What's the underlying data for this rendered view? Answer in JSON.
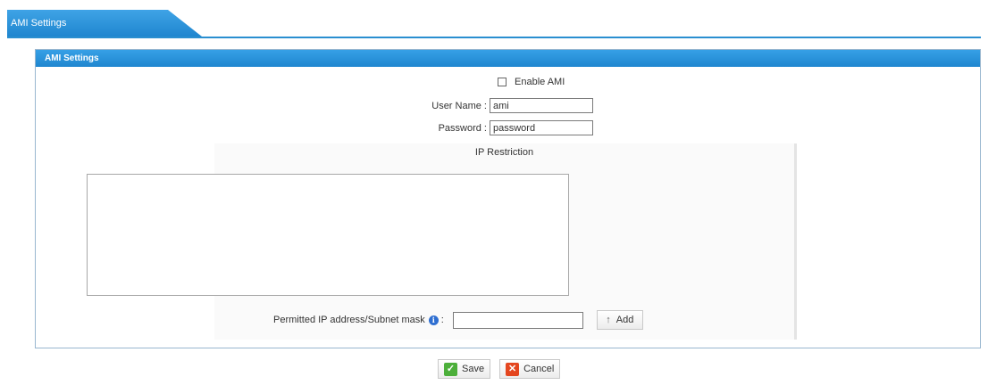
{
  "tab": {
    "label": "AMI Settings"
  },
  "panel": {
    "title": "AMI Settings",
    "enable_ami_label": "Enable AMI",
    "username": {
      "label": "User Name :",
      "value": "ami"
    },
    "password": {
      "label": "Password :",
      "value": "password"
    },
    "ip_restriction": {
      "title": "IP Restriction",
      "permitted_label": "Permitted IP address/Subnet mask",
      "colon": ":",
      "ip_value": "",
      "add_label": "Add"
    }
  },
  "footer": {
    "save_label": "Save",
    "cancel_label": "Cancel"
  },
  "colors": {
    "accent": "#1f86cf",
    "save": "#4caf3a",
    "cancel": "#e4461f"
  },
  "icons": [
    "checkbox",
    "info-icon",
    "up-arrow-icon",
    "save-icon",
    "cancel-icon"
  ]
}
